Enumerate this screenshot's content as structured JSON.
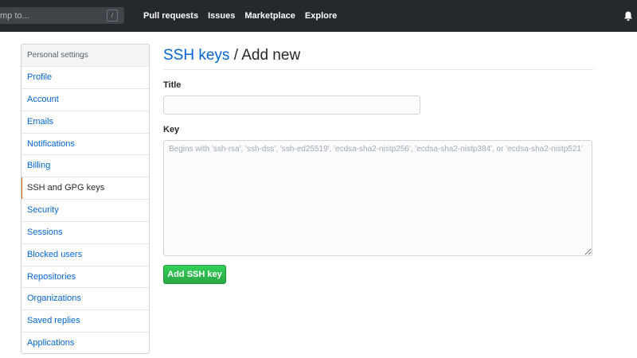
{
  "header": {
    "search": {
      "value": "",
      "placeholder": "mp to...",
      "shortcut": "/"
    },
    "nav": [
      {
        "label": "Pull requests"
      },
      {
        "label": "Issues"
      },
      {
        "label": "Marketplace"
      },
      {
        "label": "Explore"
      }
    ],
    "icons": {
      "notifications": "bell-icon"
    }
  },
  "sidebar": {
    "heading": "Personal settings",
    "selected": "SSH and GPG keys",
    "items": [
      {
        "label": "Profile"
      },
      {
        "label": "Account"
      },
      {
        "label": "Emails"
      },
      {
        "label": "Notifications"
      },
      {
        "label": "Billing"
      },
      {
        "label": "SSH and GPG keys"
      },
      {
        "label": "Security"
      },
      {
        "label": "Sessions"
      },
      {
        "label": "Blocked users"
      },
      {
        "label": "Repositories"
      },
      {
        "label": "Organizations"
      },
      {
        "label": "Saved replies"
      },
      {
        "label": "Applications"
      }
    ]
  },
  "main": {
    "breadcrumb": {
      "link": "SSH keys",
      "separator": " / ",
      "current": "Add new"
    },
    "title_field": {
      "label": "Title",
      "value": "",
      "placeholder": ""
    },
    "key_field": {
      "label": "Key",
      "value": "",
      "placeholder": "Begins with 'ssh-rsa', 'ssh-dss', 'ssh-ed25519', 'ecdsa-sha2-nistp256', 'ecdsa-sha2-nistp384', or 'ecdsa-sha2-nistp521'"
    },
    "submit_label": "Add SSH key"
  },
  "colors": {
    "header_bg": "#24292e",
    "link": "#0366d6",
    "selected_accent": "#e36209",
    "button_green": "#28a745"
  }
}
